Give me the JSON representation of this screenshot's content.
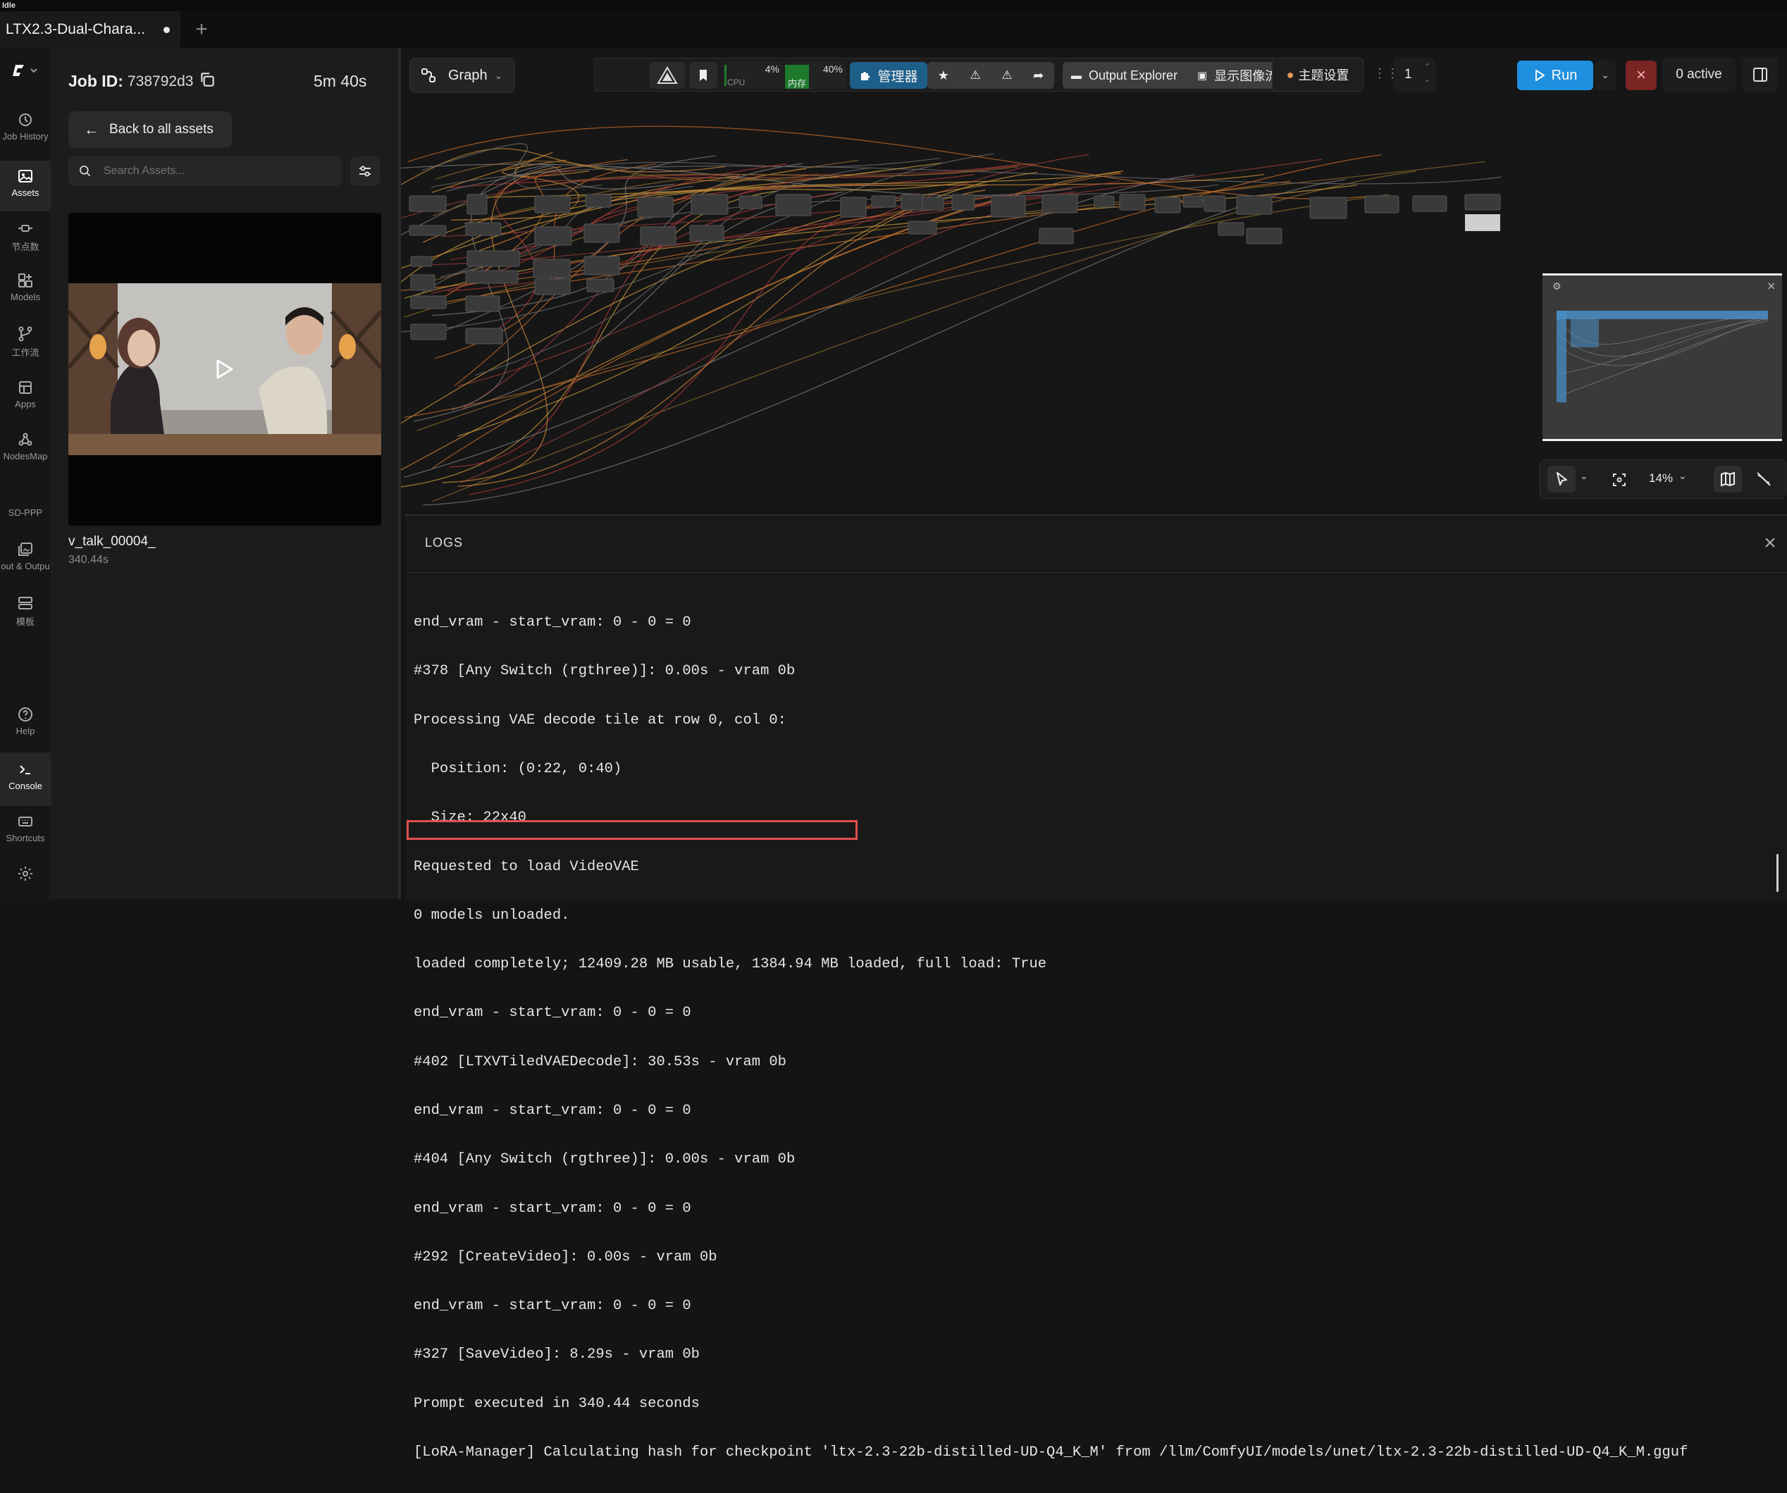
{
  "status": {
    "text": "Idle"
  },
  "tabs": {
    "active_title": "LTX2.3-Dual-Chara...",
    "new_tab_symbol": "+"
  },
  "rail": {
    "items": [
      {
        "label": "Job History",
        "icon": "history-icon"
      },
      {
        "label": "Assets",
        "icon": "image-icon",
        "active": true
      },
      {
        "label": "节点数",
        "icon": "node-icon"
      },
      {
        "label": "Models",
        "icon": "models-icon"
      },
      {
        "label": "工作流",
        "icon": "workflow-icon"
      },
      {
        "label": "Apps",
        "icon": "apps-icon"
      },
      {
        "label": "NodesMap",
        "icon": "nodesmap-icon"
      },
      {
        "label": "SD-PPP",
        "icon": ""
      },
      {
        "label": "out & Outpu",
        "icon": "gallery-icon"
      },
      {
        "label": "模板",
        "icon": "template-icon"
      },
      {
        "label": "Help",
        "icon": "help-icon"
      },
      {
        "label": "Console",
        "icon": "console-icon",
        "active": true
      },
      {
        "label": "Shortcuts",
        "icon": "keyboard-icon"
      },
      {
        "label": "",
        "icon": "settings-icon"
      }
    ]
  },
  "assets": {
    "job_label": "Job ID:",
    "job_id": "738792d3",
    "elapsed": "5m 40s",
    "back_label": "Back to all assets",
    "search_placeholder": "Search Assets...",
    "item_name": "v_talk_00004_",
    "item_duration": "340.44s"
  },
  "toolbar": {
    "graph_label": "Graph",
    "cpu_pct": "4%",
    "cpu_label": "CPU",
    "mem_pct": "40%",
    "mem_label": "内存",
    "cpu_level": 0.04,
    "mem_level": 0.4,
    "manager_label": "管理器",
    "output_explorer_label": "Output Explorer",
    "show_image_flow_label": "显示图像流",
    "theme_label": "主题设置",
    "batch_count": "1",
    "run_label": "Run",
    "active_label": "0 active"
  },
  "canvas_controls": {
    "zoom": "14%"
  },
  "logs": {
    "title": "LOGS",
    "lines": [
      "end_vram - start_vram: 0 - 0 = 0",
      "#378 [Any Switch (rgthree)]: 0.00s - vram 0b",
      "Processing VAE decode tile at row 0, col 0:",
      "  Position: (0:22, 0:40)",
      "  Size: 22x40",
      "Requested to load VideoVAE",
      "0 models unloaded.",
      "loaded completely; 12409.28 MB usable, 1384.94 MB loaded, full load: True",
      "end_vram - start_vram: 0 - 0 = 0",
      "#402 [LTXVTiledVAEDecode]: 30.53s - vram 0b",
      "end_vram - start_vram: 0 - 0 = 0",
      "#404 [Any Switch (rgthree)]: 0.00s - vram 0b",
      "end_vram - start_vram: 0 - 0 = 0",
      "#292 [CreateVideo]: 0.00s - vram 0b",
      "end_vram - start_vram: 0 - 0 = 0",
      "#327 [SaveVideo]: 8.29s - vram 0b",
      "Prompt executed in 340.44 seconds",
      "[LoRA-Manager] Calculating hash for checkpoint 'ltx-2.3-22b-distilled-UD-Q4_K_M' from /llm/ComfyUI/models/unet/ltx-2.3-22b-distilled-UD-Q4_K_M.gguf"
    ]
  },
  "colors": {
    "run_blue": "#1f8fe0",
    "manager_blue": "#1e5f8a",
    "highlight_red": "#e0504f",
    "mem_green": "#1d7a2c",
    "stop_red": "#7a2424"
  }
}
